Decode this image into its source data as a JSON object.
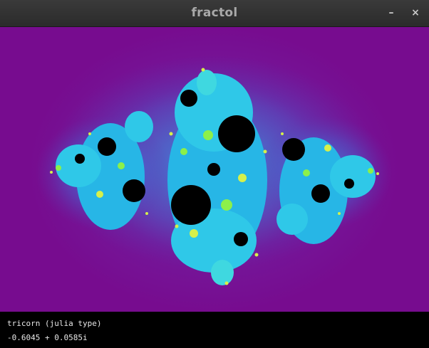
{
  "window": {
    "title": "fractol",
    "minimize_glyph": "–",
    "close_glyph": "×"
  },
  "fractal": {
    "name_line": "tricorn (julia type)",
    "parameter_line": "-0.6045 + 0.0585i",
    "background_color": "#770c8f",
    "glow_color": "#5a52c0",
    "detail_colors": [
      "#2fd0e6",
      "#22b8e8",
      "#8cf04a",
      "#d6f04a",
      "#000000"
    ]
  }
}
